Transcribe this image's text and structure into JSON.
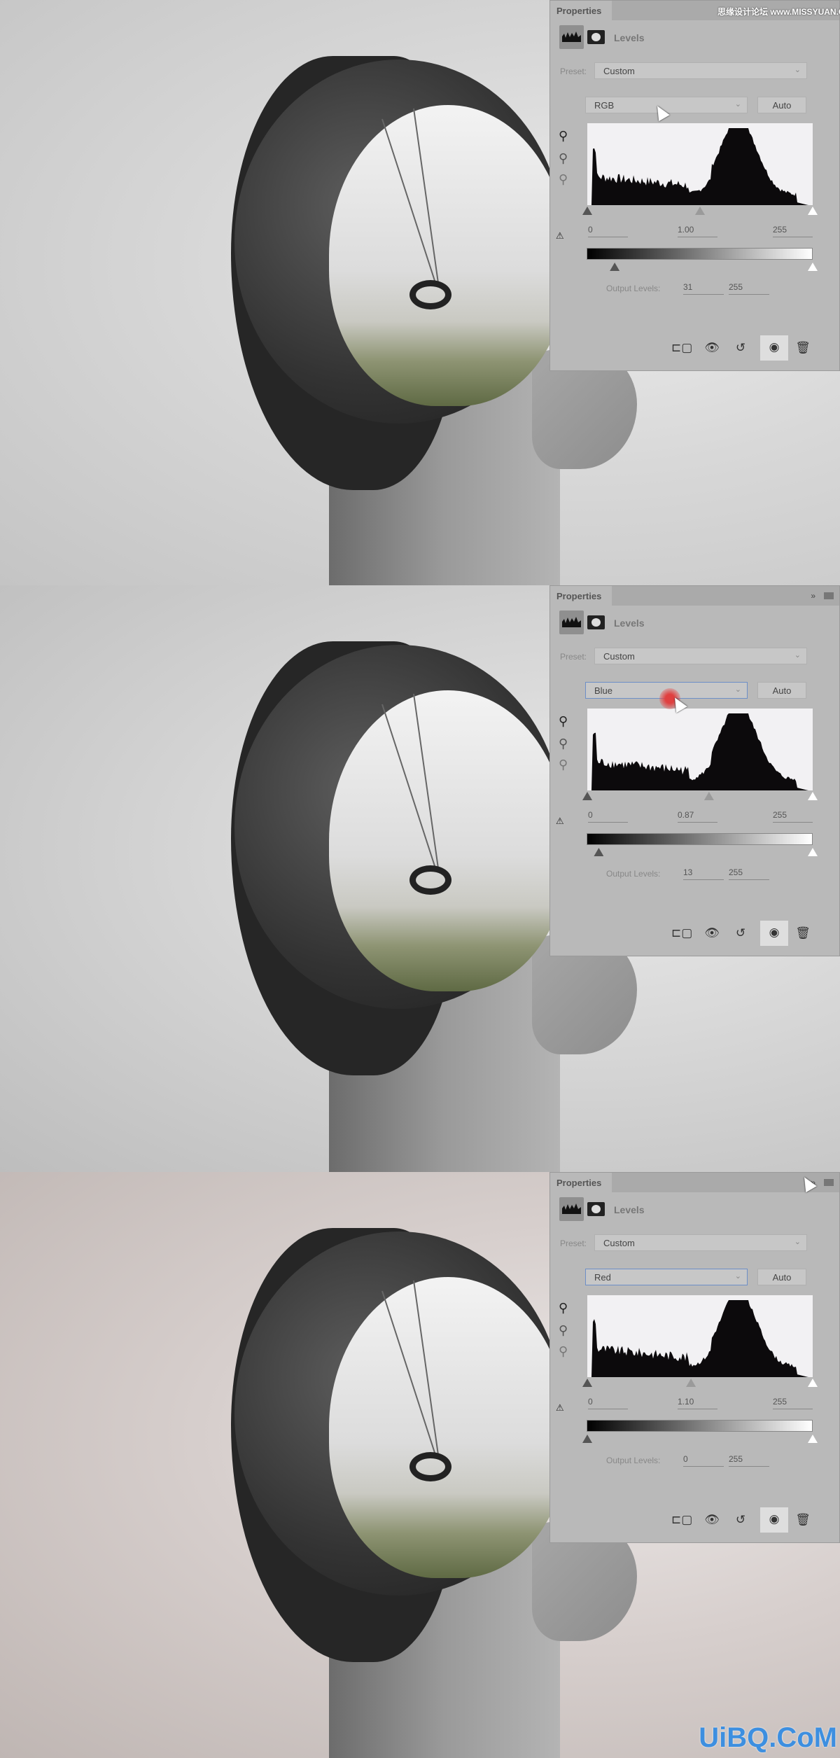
{
  "watermarks": {
    "top": "思缘设计论坛 www.MISSYUAN.COM",
    "bottom": "UiBQ.CoM"
  },
  "panels": [
    {
      "title": "Properties",
      "adjustment": "Levels",
      "preset_label": "Preset:",
      "preset": "Custom",
      "channel": "RGB",
      "auto": "Auto",
      "input_black": "0",
      "input_gamma": "1.00",
      "input_white": "255",
      "gamma_position_pct": 50,
      "output_label": "Output Levels:",
      "output_black": "31",
      "output_white": "255",
      "channel_focused": false
    },
    {
      "title": "Properties",
      "adjustment": "Levels",
      "preset_label": "Preset:",
      "preset": "Custom",
      "channel": "Blue",
      "auto": "Auto",
      "input_black": "0",
      "input_gamma": "0.87",
      "input_white": "255",
      "gamma_position_pct": 54,
      "output_label": "Output Levels:",
      "output_black": "13",
      "output_white": "255",
      "channel_focused": true
    },
    {
      "title": "Properties",
      "adjustment": "Levels",
      "preset_label": "Preset:",
      "preset": "Custom",
      "channel": "Red",
      "auto": "Auto",
      "input_black": "0",
      "input_gamma": "1.10",
      "input_white": "255",
      "gamma_position_pct": 46,
      "output_label": "Output Levels:",
      "output_black": "0",
      "output_white": "255",
      "channel_focused": true
    }
  ],
  "icons": {
    "expand": "double-chevron-icon",
    "menu": "panel-menu-icon"
  },
  "toolbar_icons": [
    "clip-to-layer-icon",
    "view-previous-icon",
    "reset-icon",
    "visibility-icon",
    "delete-icon"
  ],
  "colors": {
    "panel_bg": "#b9b9b9",
    "focus_border": "#6d8fc7",
    "watermark_blue": "#3d8fe0"
  }
}
